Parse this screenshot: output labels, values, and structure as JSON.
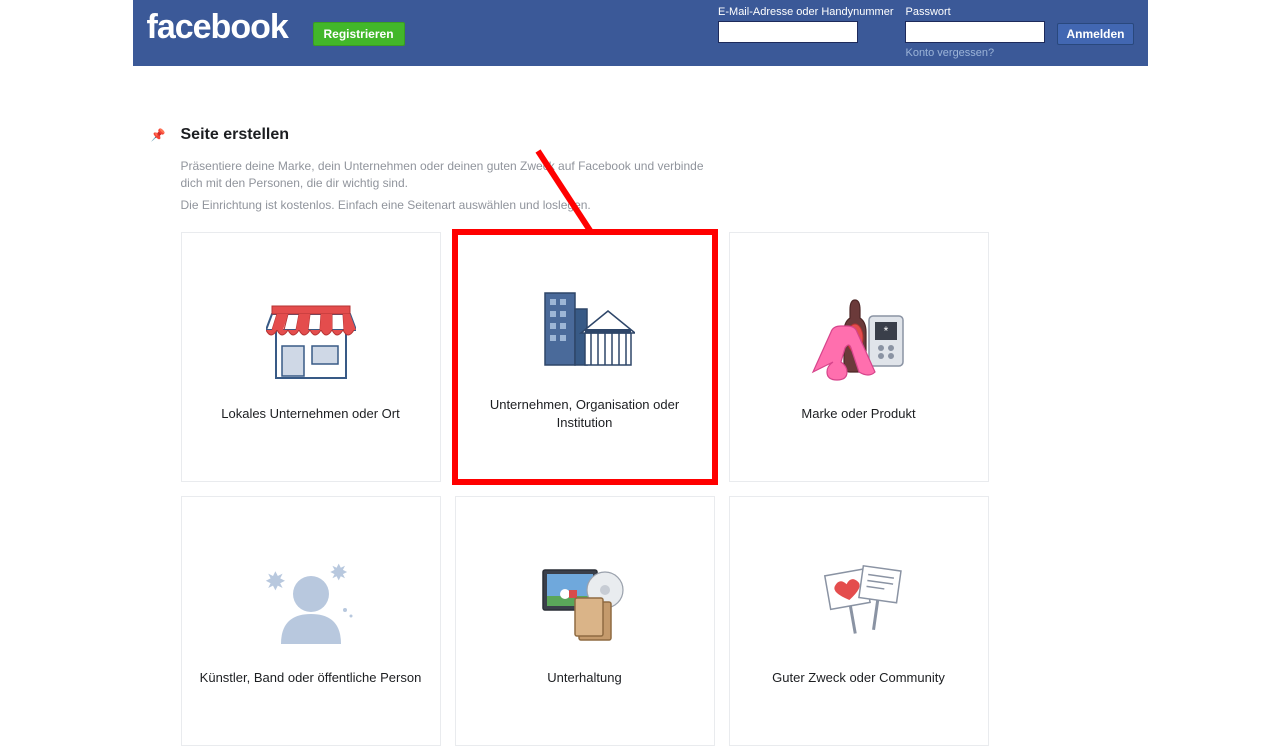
{
  "header": {
    "logo": "facebook",
    "register_label": "Registrieren",
    "email_label": "E-Mail-Adresse oder Handynummer",
    "password_label": "Passwort",
    "login_label": "Anmelden",
    "forgot_label": "Konto vergessen?"
  },
  "page": {
    "title": "Seite erstellen",
    "desc": "Präsentiere deine Marke, dein Unternehmen oder deinen guten Zweck auf Facebook und verbinde dich mit den Personen, die dir wichtig sind.",
    "sub": "Die Einrichtung ist kostenlos. Einfach eine Seitenart auswählen und loslegen."
  },
  "cards": {
    "local": "Lokales Unternehmen oder Ort",
    "company": "Unternehmen, Organisation oder Institution",
    "brand": "Marke oder Produkt",
    "artist": "Künstler, Band oder öffentliche Person",
    "entertainment": "Unterhaltung",
    "cause": "Guter Zweck oder Community"
  }
}
